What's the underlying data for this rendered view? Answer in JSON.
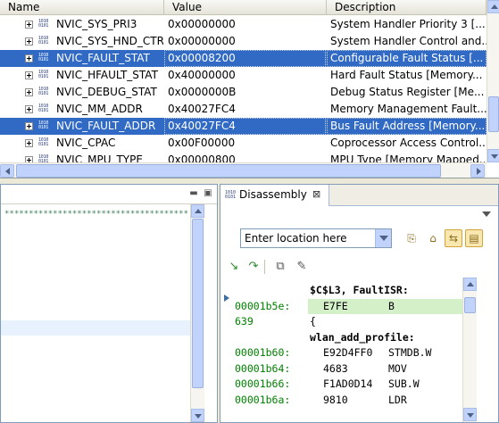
{
  "registers": {
    "columns": [
      "Name",
      "Value",
      "Description"
    ],
    "rows": [
      {
        "name": "NVIC_SYS_PRI3",
        "value": "0x00000000",
        "desc": "System Handler Priority 3 [...",
        "selected": false
      },
      {
        "name": "NVIC_SYS_HND_CTRL",
        "value": "0x00000000",
        "desc": "System Handler Control and...",
        "selected": false
      },
      {
        "name": "NVIC_FAULT_STAT",
        "value": "0x00008200",
        "desc": "Configurable Fault Status [...",
        "selected": true
      },
      {
        "name": "NVIC_HFAULT_STAT",
        "value": "0x40000000",
        "desc": "Hard Fault Status [Memory...",
        "selected": false
      },
      {
        "name": "NVIC_DEBUG_STAT",
        "value": "0x0000000B",
        "desc": "Debug Status Register [Me...",
        "selected": false
      },
      {
        "name": "NVIC_MM_ADDR",
        "value": "0x40027FC4",
        "desc": "Memory Management Fault...",
        "selected": false
      },
      {
        "name": "NVIC_FAULT_ADDR",
        "value": "0x40027FC4",
        "desc": "Bus Fault Address [Memory...",
        "selected": true
      },
      {
        "name": "NVIC_CPAC",
        "value": "0x00F00000",
        "desc": "Coprocessor Access Control...",
        "selected": false
      },
      {
        "name": "NVIC_MPU_TYPE",
        "value": "0x00000800",
        "desc": "MPU Type [Memory Mapped...",
        "selected": false
      }
    ],
    "register_icon_text": "1010\n0101"
  },
  "disassembly": {
    "tab_label": "Disassembly",
    "close_glyph": "⊠",
    "location_placeholder": "Enter location here",
    "lines": [
      {
        "kind": "label",
        "text": "$C$L3, FaultISR:"
      },
      {
        "kind": "instr",
        "addr": "00001b5e:",
        "opcode": "E7FE",
        "mnemonic": "B",
        "current": true
      },
      {
        "kind": "source",
        "addr": " 639",
        "text": "{"
      },
      {
        "kind": "label",
        "text": "wlan_add_profile:"
      },
      {
        "kind": "instr",
        "addr": "00001b60:",
        "opcode": "E92D4FF0",
        "mnemonic": "STMDB.W"
      },
      {
        "kind": "instr",
        "addr": "00001b64:",
        "opcode": "4683",
        "mnemonic": "MOV"
      },
      {
        "kind": "instr",
        "addr": "00001b66:",
        "opcode": "F1AD0D14",
        "mnemonic": "SUB.W"
      },
      {
        "kind": "instr",
        "addr": "00001b6a:",
        "opcode": "9810",
        "mnemonic": "LDR"
      }
    ]
  },
  "editor": {
    "comment_stars": "****************************************"
  },
  "colors": {
    "selection": "#316ac5",
    "address_green": "#008000",
    "current_line": "#d4f0c8"
  }
}
